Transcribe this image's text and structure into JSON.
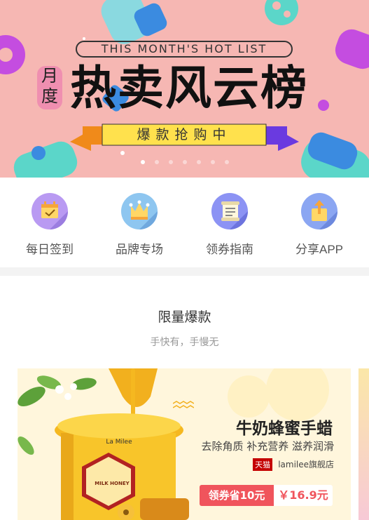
{
  "banner": {
    "hot_list_label": "THIS MONTH'S HOT LIST",
    "month_tag": "月度",
    "title": "热卖风云榜",
    "ribbon": "爆款抢购中",
    "slide_count": 7,
    "active_slide": 1
  },
  "quick_entries": [
    {
      "label": "每日签到",
      "icon": "calendar-check-icon",
      "color": "#b99af2"
    },
    {
      "label": "品牌专场",
      "icon": "crown-icon",
      "color": "#8ec6f0"
    },
    {
      "label": "领券指南",
      "icon": "scroll-icon",
      "color": "#8c93f4"
    },
    {
      "label": "分享APP",
      "icon": "share-icon",
      "color": "#8ba6f2"
    }
  ],
  "section": {
    "title": "限量爆款",
    "subtitle": "手快有，手慢无"
  },
  "product": {
    "title": "牛奶蜂蜜手蜡",
    "desc": "去除角质 补充营养 滋养润滑",
    "platform": "天猫",
    "shop": "lamilee旗舰店",
    "coupon": "领券省10元",
    "price": "￥16.9元",
    "jar_brand": "La Milee",
    "jar_label": "MILK HONEY"
  },
  "colors": {
    "banner_bg": "#f6b7b3",
    "accent_red": "#f0545c",
    "ribbon_yellow": "#ffe14d"
  }
}
